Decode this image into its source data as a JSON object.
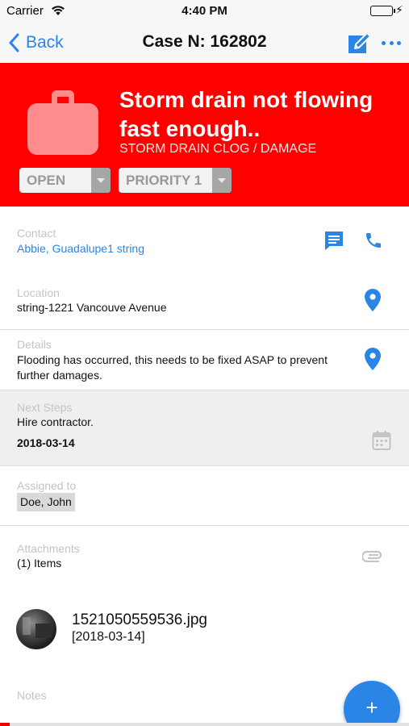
{
  "status_bar": {
    "carrier": "Carrier",
    "time": "4:40 PM",
    "bolt": "⚡",
    "wifi_icon": "wifi-icon",
    "battery_icon": "battery-icon",
    "battery_level": 1.0
  },
  "nav": {
    "back_label": "Back",
    "title": "Case N: 162802",
    "edit_icon": "edit-icon",
    "more_icon": "more-icon",
    "accent_color": "#2a85e6"
  },
  "case": {
    "title": "Storm drain not flowing fast enough..",
    "category": "STORM DRAIN CLOG / DAMAGE",
    "status": "OPEN",
    "priority": "PRIORITY 1",
    "header_color": "#fe0000",
    "category_icon": "briefcase-icon"
  },
  "contact": {
    "label": "Contact",
    "value": "Abbie, Guadalupe1 string",
    "message_icon": "message-icon",
    "phone_icon": "phone-icon"
  },
  "location": {
    "label": "Location",
    "value": "string-1221 Vancouve Avenue",
    "pin_icon": "map-pin-icon"
  },
  "details": {
    "label": "Details",
    "line1": "Flooding has occurred, this needs to be fixed ASAP to prevent",
    "line2": "further damages.",
    "pin_icon": "map-pin-icon"
  },
  "next_steps": {
    "label": "Next Steps",
    "value": "Hire contractor.",
    "date": "2018-03-14",
    "calendar_icon": "calendar-icon"
  },
  "assigned": {
    "label": "Assigned to",
    "value": "Doe, John"
  },
  "attachments": {
    "label": "Attachments",
    "count_text": "(1) Items",
    "clip_icon": "paperclip-icon",
    "items": [
      {
        "name": "1521050559536.jpg",
        "date": "[2018-03-14]"
      }
    ]
  },
  "notes": {
    "label": "Notes"
  },
  "fab": {
    "label": "+",
    "icon": "add-icon"
  }
}
